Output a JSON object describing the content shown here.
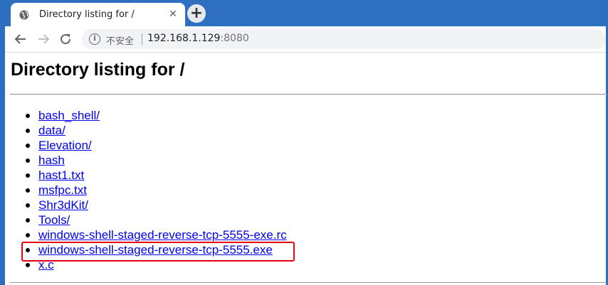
{
  "browser": {
    "tab_title": "Directory listing for /",
    "tab_close": "✕",
    "new_tab": "+",
    "security_label": "不安全",
    "url_host": "192.168.1.129",
    "url_port": ":8080"
  },
  "page": {
    "heading": "Directory listing for /",
    "entries": [
      "bash_shell/",
      "data/",
      "Elevation/",
      "hash",
      "hast1.txt",
      "msfpc.txt",
      "Shr3dKit/",
      "Tools/",
      "windows-shell-staged-reverse-tcp-5555-exe.rc",
      "windows-shell-staged-reverse-tcp-5555.exe",
      "x.c"
    ]
  },
  "colors": {
    "tab_strip": "#2f6fc0",
    "link": "#0000ee",
    "highlight_box": "#e3000f"
  }
}
